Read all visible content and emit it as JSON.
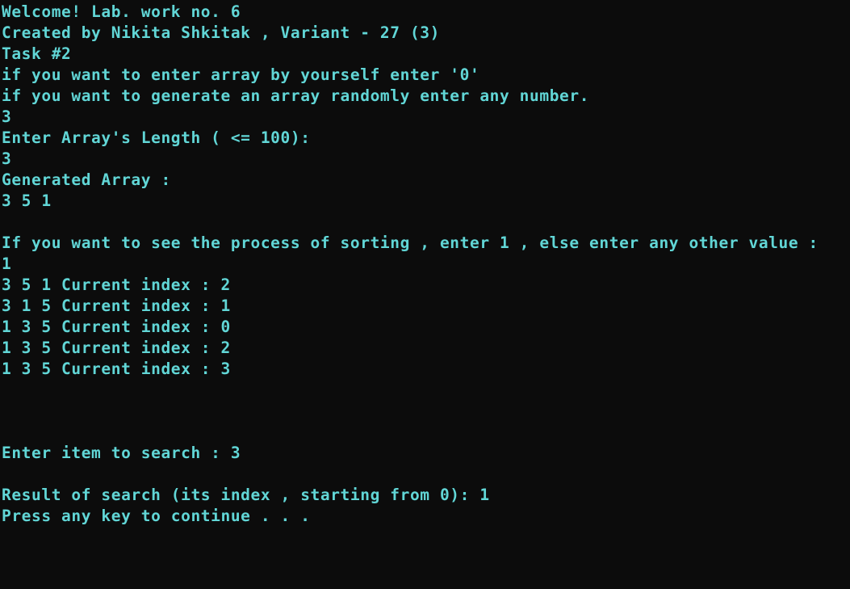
{
  "console": {
    "text_color": "#61d6d6",
    "background_color": "#0c0c0c",
    "lines": [
      "Welcome! Lab. work no. 6",
      "Created by Nikita Shkitak , Variant - 27 (3)",
      "Task #2",
      "if you want to enter array by yourself enter '0'",
      "if you want to generate an array randomly enter any number.",
      "3",
      "Enter Array's Length ( <= 100):",
      "3",
      "Generated Array :",
      "3 5 1",
      "",
      "If you want to see the process of sorting , enter 1 , else enter any other value :",
      "1",
      "3 5 1 Current index : 2",
      "3 1 5 Current index : 1",
      "1 3 5 Current index : 0",
      "1 3 5 Current index : 2",
      "1 3 5 Current index : 3",
      "",
      "",
      "",
      "Enter item to search : 3",
      "",
      "Result of search (its index , starting from 0): 1",
      "Press any key to continue . . ."
    ]
  }
}
